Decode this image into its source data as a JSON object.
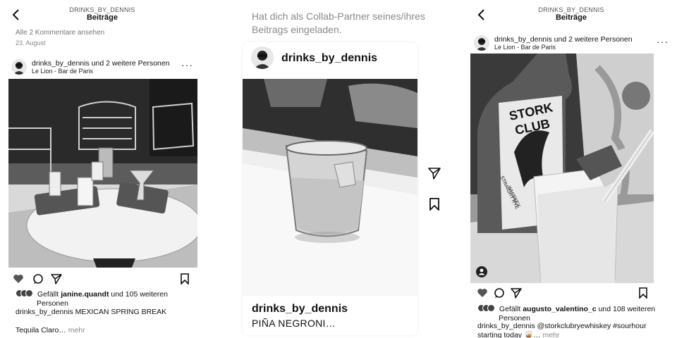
{
  "left": {
    "header": {
      "username": "DRINKS_BY_DENNIS",
      "title": "Beiträge"
    },
    "view_comments": "Alle 2 Kommentare ansehen",
    "date": "23. August",
    "post": {
      "user": "drinks_by_dennis",
      "coauthors": "und 2 weitere Personen",
      "location": "Le Lion - Bar de Paris",
      "likes_prefix": "Gefällt",
      "likes_user": "janine.quandt",
      "likes_suffix": "und 105 weiteren",
      "likes_line2": "Personen",
      "caption_user": "drinks_by_dennis",
      "caption_text": "MEXICAN SPRING BREAK",
      "caption_more_text": "Tequila Claro…",
      "more": "mehr"
    }
  },
  "middle": {
    "message": "Hat dich als Collab-Partner seines/ihres Beitrags eingeladen.",
    "card_user": "drinks_by_dennis",
    "card_caption_user": "drinks_by_dennis",
    "card_caption_text": "PIÑA NEGRONI…"
  },
  "right": {
    "header": {
      "username": "DRINKS_BY_DENNIS",
      "title": "Beiträge"
    },
    "post": {
      "user": "drinks_by_dennis",
      "coauthors": "und 2 weitere Personen",
      "location": "Le Lion - Bar de Paris",
      "bottle_label_1": "STORK",
      "bottle_label_2": "CLUB",
      "bottle_label_3": "STRAIGHT RYE",
      "bottle_label_4": "WHISKEY",
      "likes_prefix": "Gefällt",
      "likes_user": "augusto_valentino_c",
      "likes_suffix": "und 108 weiteren",
      "likes_line2": "Personen",
      "caption_user": "drinks_by_dennis",
      "caption_text": "@storkclubryewhiskey #sourhour",
      "caption_line2": "starting today 🥃…",
      "more": "mehr"
    }
  },
  "icons": [
    "back-icon",
    "more-icon",
    "heart-icon",
    "comment-icon",
    "share-icon",
    "bookmark-icon",
    "tag-person-icon"
  ]
}
